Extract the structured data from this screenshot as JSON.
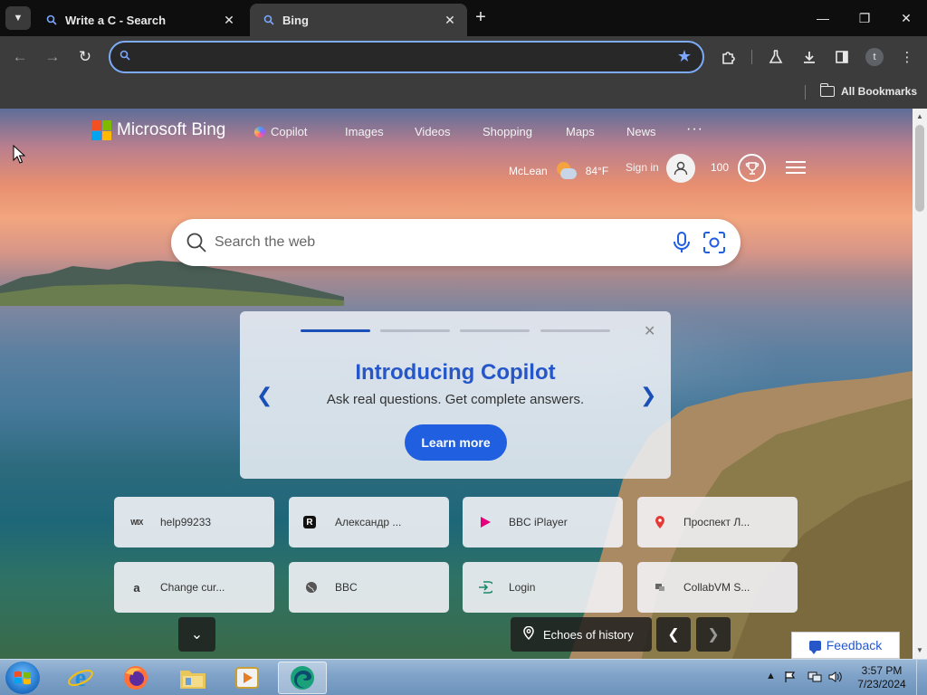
{
  "browser": {
    "tabs": [
      {
        "title": "Write a C - Search",
        "favicon": "bing-search-icon",
        "active": false
      },
      {
        "title": "Bing",
        "favicon": "bing-search-icon",
        "active": true
      }
    ],
    "address_value": "",
    "bookmarks_label": "All Bookmarks"
  },
  "bing": {
    "logo_text": "Microsoft Bing",
    "nav": [
      "Copilot",
      "Images",
      "Videos",
      "Shopping",
      "Maps",
      "News"
    ],
    "more": "···",
    "location": "McLean",
    "temperature": "84°F",
    "sign_in": "Sign in",
    "rewards_points": "100",
    "search_placeholder": "Search the web",
    "carousel": {
      "title": "Introducing Copilot",
      "subtitle": "Ask real questions. Get complete answers.",
      "button": "Learn more",
      "active_slide": 1,
      "slide_count": 4
    },
    "quicklinks": [
      {
        "label": "help99233",
        "icon": "wix-icon"
      },
      {
        "label": "Александр ...",
        "icon": "r-logo-icon"
      },
      {
        "label": "BBC iPlayer",
        "icon": "bbc-iplayer-icon"
      },
      {
        "label": "Проспект Л...",
        "icon": "map-pin-icon"
      },
      {
        "label": "Change cur...",
        "icon": "amazon-icon"
      },
      {
        "label": "BBC",
        "icon": "globe-icon"
      },
      {
        "label": "Login",
        "icon": "login-icon"
      },
      {
        "label": "CollabVM S...",
        "icon": "collabvm-icon"
      }
    ],
    "image_caption": "Echoes of history",
    "feedback": "Feedback"
  },
  "taskbar": {
    "time": "3:57 PM",
    "date": "7/23/2024"
  },
  "colors": {
    "accent": "#1f5fe0",
    "chrome_dark": "#0e0e0e",
    "chrome_toolbar": "#3c3c3c",
    "omnibox_border": "#7cacf8"
  }
}
